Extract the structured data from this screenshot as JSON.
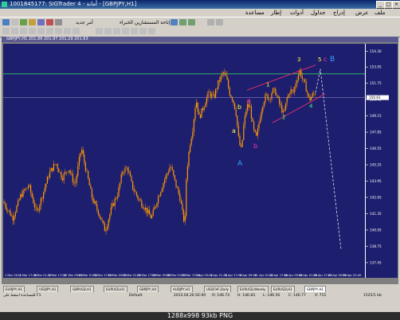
{
  "window": {
    "title": "1001845177: SIGTrader 4 - أمانة - [GBPJPY,H1]"
  },
  "menu": [
    "ملف",
    "عرض",
    "إدراج",
    "جداول",
    "أدوات",
    "إطار",
    "مساعدة"
  ],
  "toolbar": {
    "new_order": "أمر جديد",
    "experts": "إتاحة المستشارين الخبراء"
  },
  "chart": {
    "header": "GBPJPY,H1  201.86 201.97 201.29 201.63",
    "price_labels": [
      "154.30",
      "153.05",
      "151.75",
      "150.45",
      "149.15",
      "147.85",
      "146.55",
      "145.25",
      "143.95",
      "142.65",
      "141.35",
      "140.05",
      "138.75",
      "137.45"
    ],
    "current_price": "150.61",
    "top_line_price": "152.50",
    "time_labels": [
      "1 Mar 2013",
      "4 Mar 17:00",
      "6 Mar 01:00",
      "8 Mar 17:00",
      "12 Mar 09:00",
      "14 Mar 01:00",
      "15 Mar 17:00",
      "19 Mar 09:00",
      "21 Mar 01:00",
      "22 Mar 17:00",
      "26 Mar 09:00",
      "28 Mar 01:00",
      "29 Mar 17:00",
      "2 Apr 09:00",
      "4 Apr 01:00",
      "5 Apr 17:00",
      "9 Apr 09:00",
      "11 Apr 01:00",
      "12 Apr 17:00",
      "16 Apr 09:00",
      "18 Apr 01:00",
      "19 Apr 17:00",
      "23 Apr 09:00",
      "25 Apr 01:00"
    ],
    "wave_labels": {
      "w1": "1",
      "w2": "2",
      "w3": "3",
      "w4": "4",
      "w5": "5",
      "a_mag": "a",
      "b_mag": "b",
      "a_yel": "a",
      "b_yel": "b",
      "A": "A",
      "B": "B",
      "C": "C",
      "c": "c"
    }
  },
  "tabs": [
    "EURJPY,H1",
    "USDJPY,H1",
    "GBPUSD,H1",
    "EURUSD,H1",
    "GBPJPY,H4",
    "AUDJPY,H1",
    "USDCHF,Daily",
    "EURUSD,Weekly",
    "EURUSD,H1",
    "GBPJPY,H1"
  ],
  "active_tab": "GBPJPY,H1",
  "status": {
    "help": "للمساعدة اضغط على F1",
    "profile": "Default",
    "time": "2013.04.26 02:00",
    "open": "O: 146.73",
    "high": "H: 146.83",
    "low": "L: 146.56",
    "close": "C: 146.77",
    "volume": "V: 715",
    "traffic": "1525/1 kb"
  },
  "caption": "1288x998  93kb  PNG",
  "colors": {
    "background": "#1e1e6e",
    "candles": "#ff9900",
    "price_line": "#33cc66",
    "channel": "#ff3366",
    "projection": "#ffffff"
  }
}
